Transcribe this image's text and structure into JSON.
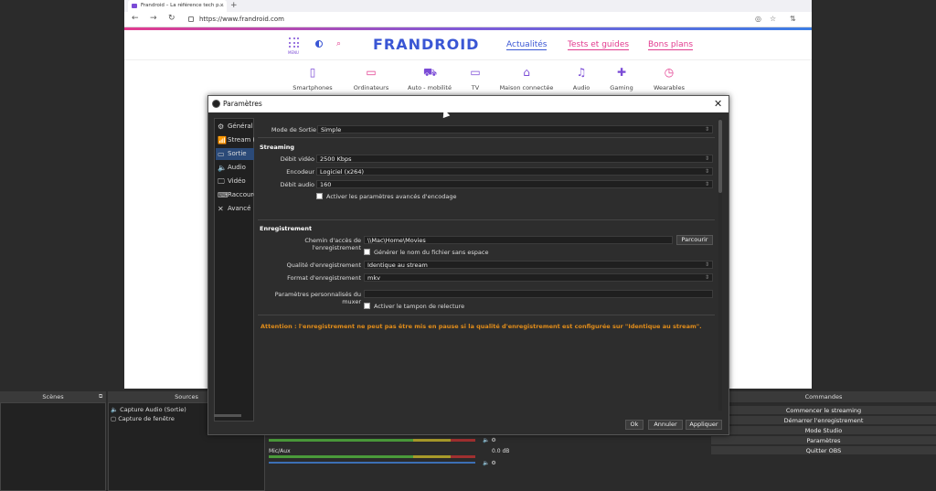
{
  "browser": {
    "tab_title": "Frandroid – La référence tech p...",
    "tab_close": "×",
    "new_tab": "+",
    "url": "https://www.frandroid.com",
    "back": "←",
    "forward": "→",
    "reload": "↻"
  },
  "site": {
    "menu_label": "MENU",
    "logo": "FRANDROID",
    "links": [
      "Actualités",
      "Tests et guides",
      "Bons plans"
    ],
    "categories": [
      "Smartphones",
      "Ordinateurs",
      "Auto - mobilité",
      "TV",
      "Maison connectée",
      "Audio",
      "Gaming",
      "Wearables"
    ],
    "colors": {
      "brand_blue": "#3a56d4",
      "brand_pink": "#e23b8f",
      "brand_purple": "#7b4bd6"
    }
  },
  "dialog": {
    "title": "Paramètres",
    "close": "✕",
    "nav": [
      {
        "label": "Général",
        "icon": "⚙"
      },
      {
        "label": "Stream (",
        "icon": "📶"
      },
      {
        "label": "Sortie",
        "icon": "▭"
      },
      {
        "label": "Audio",
        "icon": "🔈"
      },
      {
        "label": "Vidéo",
        "icon": "🖵"
      },
      {
        "label": "Raccourc",
        "icon": "⌨"
      },
      {
        "label": "Avancé",
        "icon": "✕"
      }
    ],
    "output_mode_label": "Mode de Sortie",
    "output_mode_value": "Simple",
    "streaming": {
      "header": "Streaming",
      "video_bitrate_label": "Débit vidéo",
      "video_bitrate_value": "2500 Kbps",
      "encoder_label": "Encodeur",
      "encoder_value": "Logiciel (x264)",
      "audio_bitrate_label": "Débit audio",
      "audio_bitrate_value": "160",
      "advanced_label": "Activer les paramètres avancés d'encodage"
    },
    "recording": {
      "header": "Enregistrement",
      "path_label": "Chemin d'accès de l'enregistrement",
      "path_value": "\\\\Mac\\Home\\Movies",
      "browse_label": "Parcourir",
      "nospace_label": "Générer le nom du fichier sans espace",
      "quality_label": "Qualité d'enregistrement",
      "quality_value": "Identique au stream",
      "format_label": "Format d'enregistrement",
      "format_value": "mkv",
      "muxer_label": "Paramètres personnalisés du muxer",
      "muxer_value": "",
      "replay_label": "Activer le tampon de relecture"
    },
    "warning": "Attention : l'enregistrement ne peut pas être mis en pause si la qualité d'enregistrement est configurée sur \"Identique au stream\".",
    "buttons": {
      "ok": "Ok",
      "cancel": "Annuler",
      "apply": "Appliquer"
    }
  },
  "obs": {
    "scenes_title": "Scènes",
    "sources_title": "Sources",
    "sources": [
      {
        "label": "Capture Audio (Sortie)",
        "icon": "🔈"
      },
      {
        "label": "Capture de fenêtre",
        "icon": "▢"
      }
    ],
    "mixer": {
      "track_name": "Mic/Aux",
      "track_db": "0.0 dB"
    },
    "commands_title": "Commandes",
    "commands": [
      "Commencer le streaming",
      "Démarrer l'enregistrement",
      "Mode Studio",
      "Paramètres",
      "Quitter OBS"
    ]
  }
}
